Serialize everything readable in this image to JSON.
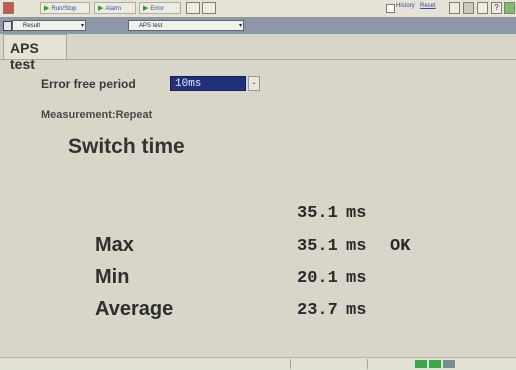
{
  "toolbar": {
    "run_stop": "Run/Stop",
    "alarm": "Alarm",
    "error": "Error",
    "history": "History",
    "reset": "Reset"
  },
  "selectbar": {
    "left_select": "Result",
    "right_select": "APS test"
  },
  "tab": {
    "label": "APS test"
  },
  "form": {
    "error_free_label": "Error free period",
    "error_free_value": "10ms",
    "measurement_label": "Measurement:Repeat"
  },
  "results": {
    "heading": "Switch time",
    "current": {
      "value": "35.1",
      "unit": "ms"
    },
    "rows": [
      {
        "label": "Max",
        "value": "35.1",
        "unit": "ms",
        "status": "OK"
      },
      {
        "label": "Min",
        "value": "20.1",
        "unit": "ms",
        "status": ""
      },
      {
        "label": "Average",
        "value": "23.7",
        "unit": "ms",
        "status": ""
      }
    ]
  },
  "colors": {
    "background": "#d7d6c8",
    "selected_field": "#21307a",
    "led_green": "#3aa64a",
    "led_gray": "#7d8a8a"
  }
}
